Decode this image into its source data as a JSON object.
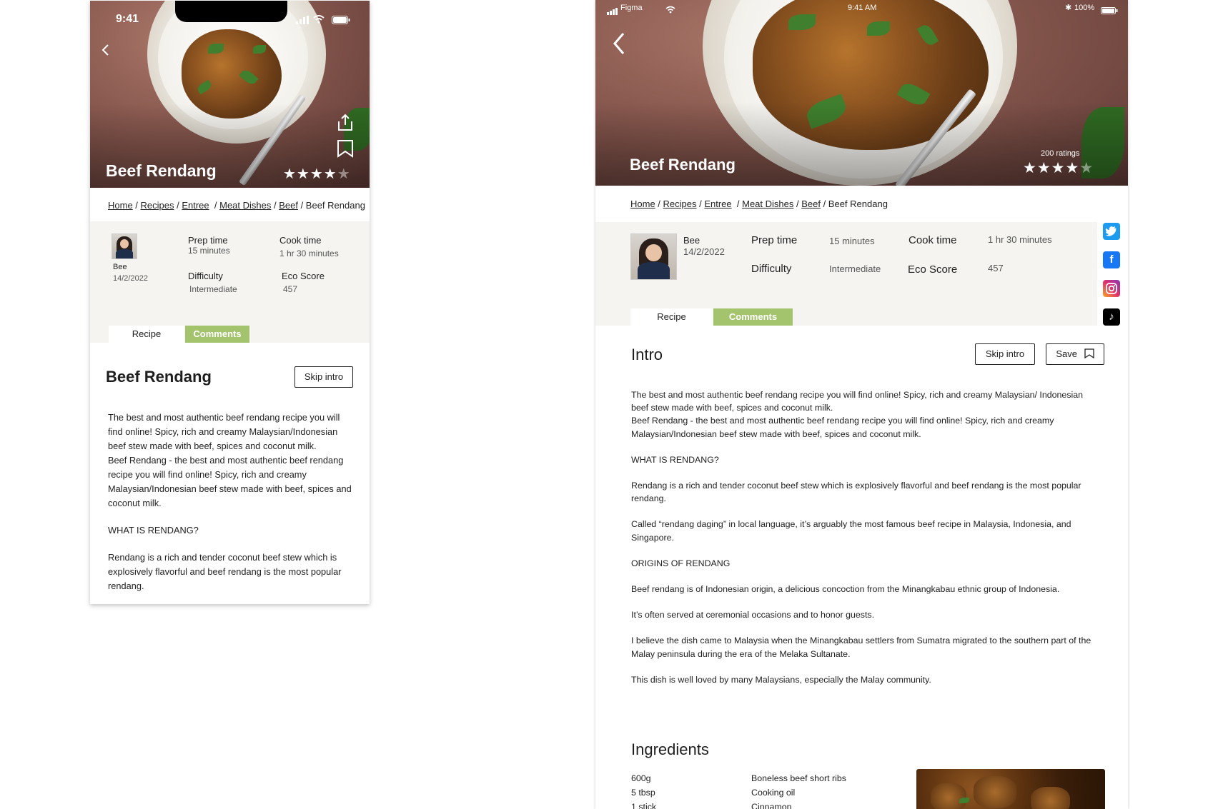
{
  "phone": {
    "status": {
      "time": "9:41"
    },
    "hero": {
      "title": "Beef Rendang",
      "stars": "★★★★",
      "stars_dim": "★"
    },
    "breadcrumb": {
      "home": "Home",
      "recipes": "Recipes",
      "entree": "Entree",
      "meat_dishes": "Meat Dishes",
      "beef": "Beef",
      "current": "Beef Rendang"
    },
    "author": {
      "name": "Bee",
      "date": "14/2/2022"
    },
    "prep": {
      "label": "Prep time",
      "value": "15 minutes"
    },
    "cook": {
      "label": "Cook time",
      "value": "1 hr  30 minutes"
    },
    "difficulty": {
      "label": "Difficulty",
      "value": "Intermediate"
    },
    "eco": {
      "label": "Eco Score",
      "value": "457"
    },
    "tabs": {
      "recipe": "Recipe",
      "comments": "Comments"
    },
    "title": "Beef Rendang",
    "skip_intro": "Skip intro",
    "intro": {
      "p1": "The best and most authentic beef rendang recipe you will find online! Spicy, rich and creamy Malaysian/Indonesian beef stew made with beef, spices and coconut milk.",
      "p2": "Beef Rendang - the best and most authentic beef rendang recipe you will find online! Spicy, rich and creamy Malaysian/Indonesian beef stew made with beef, spices and coconut milk.",
      "p3": "WHAT IS RENDANG?",
      "p4": "Rendang is a rich and tender coconut beef stew which is explosively flavorful and beef rendang is the most popular rendang."
    }
  },
  "tablet": {
    "status": {
      "carrier": "Figma",
      "time": "9:41 AM",
      "battery": "100%"
    },
    "hero": {
      "title": "Beef Rendang",
      "ratings": "200 ratings",
      "stars": "★★★★",
      "stars_dim": "★"
    },
    "breadcrumb": {
      "home": "Home",
      "recipes": "Recipes",
      "entree": "Entree",
      "meat_dishes": "Meat Dishes",
      "beef": "Beef",
      "current": "Beef Rendang"
    },
    "author": {
      "name": "Bee",
      "date": "14/2/2022"
    },
    "prep": {
      "label": "Prep time",
      "value": "15 minutes"
    },
    "cook": {
      "label": "Cook time",
      "value": "1 hr  30 minutes"
    },
    "difficulty": {
      "label": "Difficulty",
      "value": "Intermediate"
    },
    "eco": {
      "label": "Eco Score",
      "value": "457"
    },
    "tabs": {
      "recipe": "Recipe",
      "comments": "Comments"
    },
    "intro_heading": "Intro",
    "skip_intro": "Skip intro",
    "save": "Save",
    "intro": {
      "p1a": "The best and most authentic beef rendang recipe you will find online! Spicy, rich and creamy Malaysian/ Indonesian beef stew made with beef, spices and coconut milk.",
      "p1b": "Beef Rendang - the best and most authentic beef rendang recipe you will find online! Spicy, rich and creamy Malaysian/Indonesian beef stew made with beef, spices and coconut milk.",
      "p2": "WHAT IS RENDANG?",
      "p3": "Rendang is a rich and tender coconut beef stew which is explosively flavorful and beef rendang is the most popular rendang.",
      "p4": "Called “rendang daging” in local language, it’s arguably the most famous beef recipe in Malaysia, Indonesia, and Singapore.",
      "p5": "ORIGINS OF RENDANG",
      "p6": "Beef rendang is of Indonesian origin, a delicious concoction from the Minangkabau ethnic group of Indonesia.",
      "p7": "It’s often served at ceremonial occasions and to honor guests.",
      "p8": "I believe the dish came to Malaysia when the Minangkabau settlers from Sumatra migrated to the southern part of the Malay peninsula during the era of the Melaka Sultanate.",
      "p9": "This dish is well loved by many Malaysians, especially the Malay community."
    },
    "ingredients_heading": "Ingredients",
    "ingredients": [
      {
        "qty": "600g",
        "name": "Boneless beef short ribs"
      },
      {
        "qty": "5 tbsp",
        "name": "Cooking oil"
      },
      {
        "qty": "1 stick",
        "name": "Cinnamon"
      }
    ],
    "social": [
      "twitter-icon",
      "facebook-icon",
      "instagram-icon",
      "tiktok-icon"
    ]
  },
  "colors": {
    "accent_green": "#a3c46c",
    "panel": "#f5f4f0",
    "twitter": "#1d9bf0",
    "facebook": "#1877f2",
    "instagram": "#e1306c",
    "tiktok": "#000000"
  }
}
